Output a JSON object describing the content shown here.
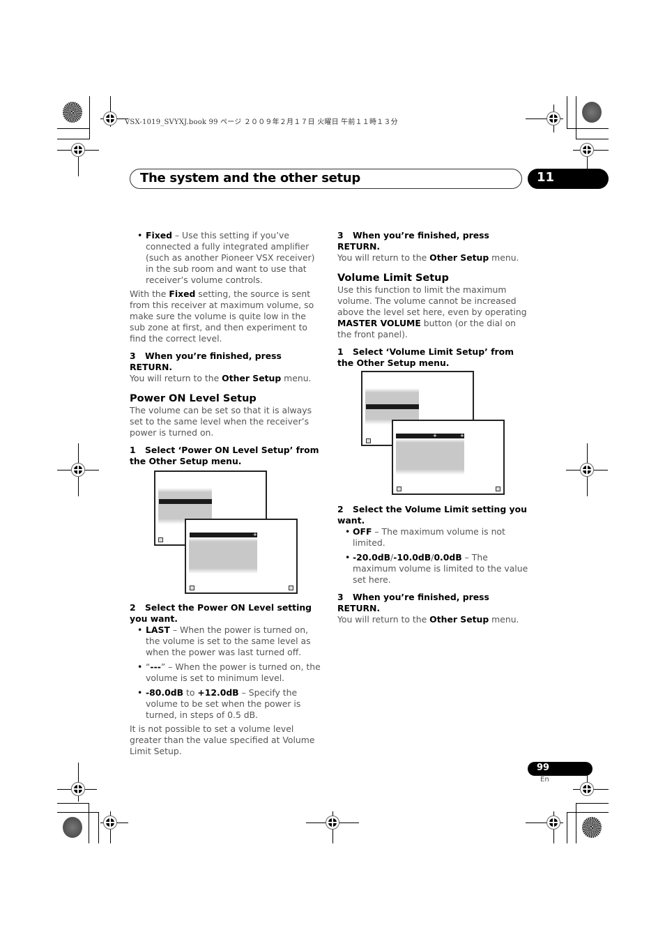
{
  "header": {
    "file_meta": "VSX-1019_SVYXJ.book  99 ページ  ２００９年２月１７日  火曜日  午前１１時１３分",
    "chapter_title": "The system and the other setup",
    "chapter_number": "11"
  },
  "left_column": {
    "fixed_bullet": {
      "term": "Fixed",
      "text": " – Use this setting if you’ve connected a fully integrated amplifier (such as another Pioneer VSX receiver) in the sub room and want to use that receiver’s volume controls."
    },
    "fixed_note": {
      "pre": "With the ",
      "term": "Fixed",
      "post": " setting, the source is sent from this receiver at maximum volume, so make sure the volume is quite low in the sub zone at first, and then experiment to find the correct level."
    },
    "step3": {
      "num": "3",
      "heading": "When you’re finished, press RETURN.",
      "pre": "You will return to the ",
      "term": "Other Setup",
      "post": " menu."
    },
    "power_on": {
      "title": "Power ON Level Setup",
      "intro": "The volume can be set so that it is always set to the same level when the receiver’s power is turned on.",
      "step1_num": "1",
      "step1": "Select ‘Power ON Level Setup’ from the Other Setup menu.",
      "step2_num": "2",
      "step2": "Select the Power ON Level setting you want.",
      "bullets": [
        {
          "term": "LAST",
          "text": " – When the power is turned on, the volume is set to the same level as when the power was last turned off."
        },
        {
          "pre": "“",
          "term": "---",
          "text": "” – When the power is turned on, the volume is set to minimum level."
        },
        {
          "term": "-80.0dB",
          "mid": " to ",
          "term2": "+12.0dB",
          "text": " – Specify the volume to be set when the power is turned, in steps of 0.5 dB."
        }
      ],
      "note": "It is not possible to set a volume level greater than the value specified at Volume Limit Setup."
    }
  },
  "right_column": {
    "step3": {
      "num": "3",
      "heading": "When you’re finished, press RETURN.",
      "pre": "You will return to the ",
      "term": "Other Setup",
      "post": " menu."
    },
    "volume_limit": {
      "title": "Volume Limit Setup",
      "intro_pre": "Use this function to limit the maximum volume. The volume cannot be increased above the level set here, even by operating ",
      "intro_term": "MASTER VOLUME",
      "intro_post": " button (or the dial on the front panel).",
      "step1_num": "1",
      "step1": "Select ‘Volume Limit Setup’ from the Other Setup menu.",
      "step2_num": "2",
      "step2": "Select the Volume Limit setting you want.",
      "bullets": [
        {
          "term": "OFF",
          "text": " – The maximum volume is not limited."
        },
        {
          "term": "-20.0dB",
          "sep1": "/",
          "term2": "-10.0dB",
          "sep2": "/",
          "term3": "0.0dB",
          "text": " – The maximum volume is limited to the value set here."
        }
      ],
      "step3_num": "3",
      "step3": "When you’re finished, press RETURN.",
      "step3_pre": "You will return to the ",
      "step3_term": "Other Setup",
      "step3_post": " menu."
    }
  },
  "osd": {
    "plus_glyph": "+"
  },
  "footer": {
    "page_number": "99",
    "language": "En"
  }
}
